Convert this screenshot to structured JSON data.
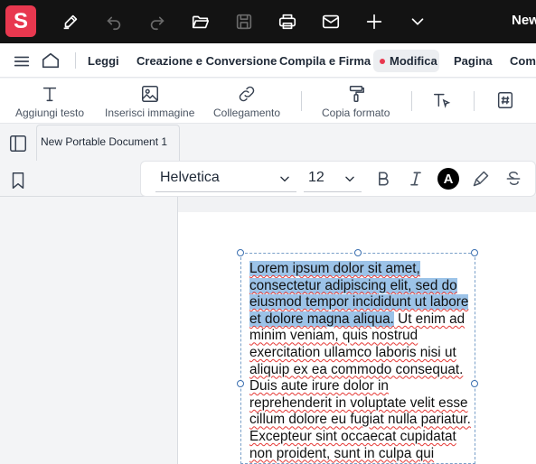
{
  "app": {
    "logo_letter": "S",
    "document_title_truncated": "New"
  },
  "titlebar": {
    "icons": [
      "pen-icon",
      "undo-icon",
      "redo-icon",
      "folder-open-icon",
      "save-icon",
      "print-icon",
      "mail-icon",
      "plus-icon",
      "chevron-down-icon"
    ]
  },
  "menu": {
    "items": [
      "Leggi",
      "Creazione e Conversione",
      "Compila e Firma",
      "Modifica",
      "Pagina",
      "Comm"
    ],
    "active": "Modifica"
  },
  "toolbar": {
    "add_text": "Aggiungi testo",
    "insert_image": "Inserisci immagine",
    "link": "Collegamento",
    "copy_format": "Copia formato"
  },
  "tab": {
    "label": "New Portable Document 1"
  },
  "format": {
    "font": "Helvetica",
    "size": "12",
    "color_letter": "A"
  },
  "document": {
    "highlighted_text": "Lorem ipsum dolor sit amet, consectetur adipiscing elit, sed do eiusmod tempor incididunt ut labore et dolore magna aliqua.",
    "body_text": " Ut enim ad minim veniam, quis nostrud exercitation ullamco laboris nisi ut aliquip ex ea commodo consequat. Duis aute irure dolor in reprehenderit in voluptate velit esse cillum dolore eu fugiat nulla pariatur. Excepteur sint occaecat cupidatat non proident, sunt in culpa qui officia"
  },
  "colors": {
    "brand": "#e8384f",
    "titlebar_bg": "#131313",
    "highlight": "#9cc3e8"
  }
}
